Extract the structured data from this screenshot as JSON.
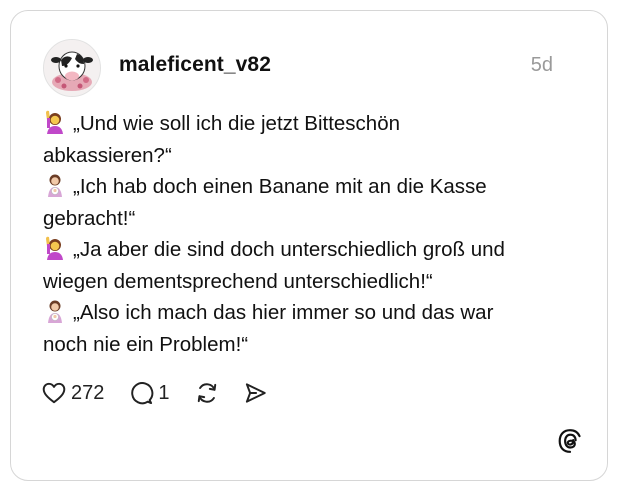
{
  "post": {
    "username": "maleficent_v82",
    "timestamp": "5d",
    "lines": [
      {
        "emoji": "woman-raising-hand",
        "text": "„Und wie soll ich die jetzt Bitteschön"
      },
      {
        "emoji": "",
        "text": "abkassieren?“"
      },
      {
        "emoji": "woman-feeding-baby",
        "text": "„Ich hab doch einen Banane mit an die Kasse"
      },
      {
        "emoji": "",
        "text": "gebracht!“"
      },
      {
        "emoji": "woman-raising-hand",
        "text": "„Ja aber die sind doch unterschiedlich groß und"
      },
      {
        "emoji": "",
        "text": "wiegen dementsprechend unterschiedlich!“"
      },
      {
        "emoji": "woman-feeding-baby",
        "text": "„Also ich mach das hier immer so und das war"
      },
      {
        "emoji": "",
        "text": "noch nie ein Problem!“"
      }
    ]
  },
  "actions": {
    "likes": "272",
    "replies": "1",
    "like_icon": "heart-icon",
    "reply_icon": "comment-bubble-icon",
    "repost_icon": "repost-icon",
    "share_icon": "send-icon"
  },
  "brand": {
    "logo_icon": "threads-logo-icon"
  }
}
